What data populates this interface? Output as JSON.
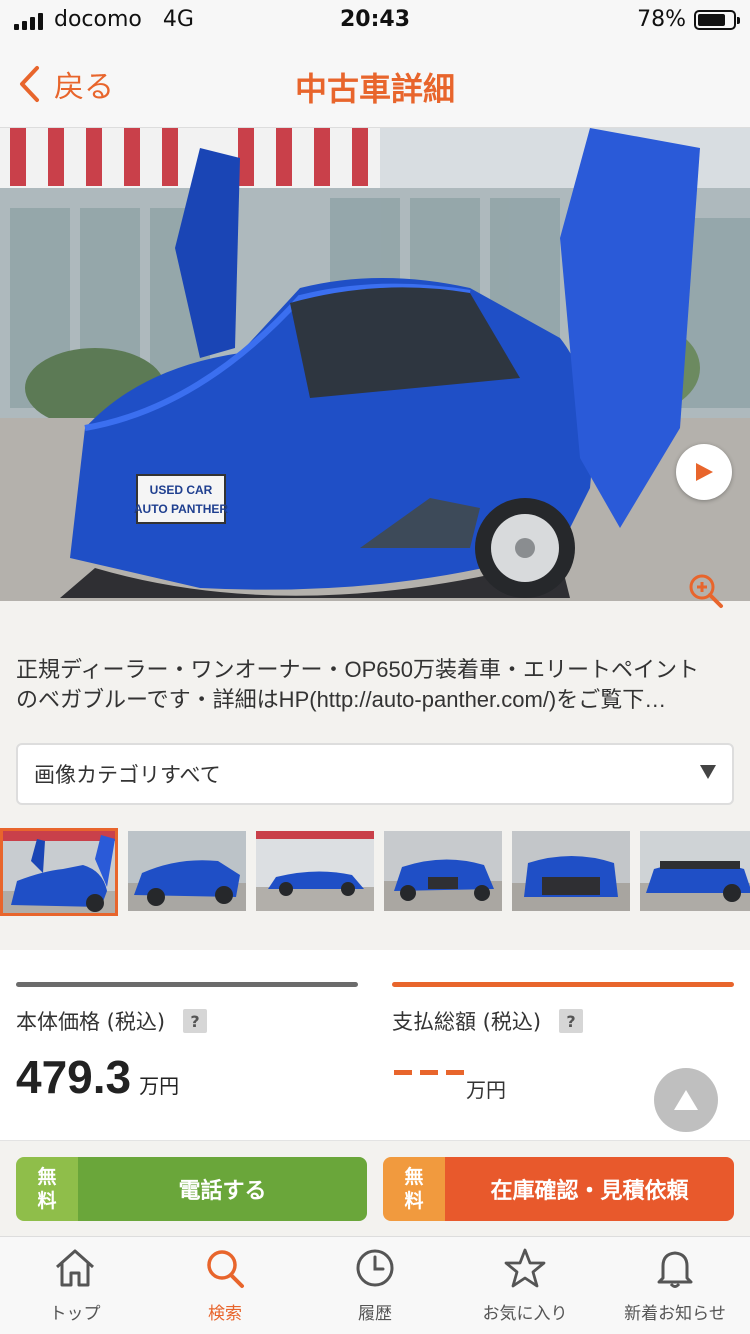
{
  "status_bar": {
    "carrier": "docomo",
    "network": "4G",
    "time": "20:43",
    "battery": "78%",
    "battery_level": 0.78
  },
  "nav": {
    "back_label": "戻る",
    "title": "中古車詳細"
  },
  "hero": {
    "plate_line1": "USED CAR",
    "plate_line2": "AUTO PANTHER"
  },
  "description": {
    "line1": "正規ディーラー・ワンオーナー・OP650万装着車・エリートペイント",
    "line2": "のベガブルーです・詳細はHP(http://auto-panther.com/)をご覧下…"
  },
  "image_category": {
    "selected": "画像カテゴリすべて"
  },
  "price": {
    "body_label": "本体価格 (税込)",
    "body_value": "479.3",
    "body_unit": "万円",
    "total_label": "支払総額 (税込)",
    "total_unit": "万円",
    "help_mark": "?"
  },
  "cta": {
    "free_label": "無料",
    "phone_label": "電話する",
    "estimate_label": "在庫確認・見積依頼"
  },
  "tabs": [
    {
      "label": "トップ",
      "icon": "home-icon"
    },
    {
      "label": "検索",
      "icon": "search-icon"
    },
    {
      "label": "履歴",
      "icon": "clock-icon"
    },
    {
      "label": "お気に入り",
      "icon": "star-icon"
    },
    {
      "label": "新着お知らせ",
      "icon": "bell-icon"
    }
  ],
  "colors": {
    "accent": "#e8652c",
    "car_blue": "#1f4fc6",
    "call_green": "#6aa63a"
  }
}
